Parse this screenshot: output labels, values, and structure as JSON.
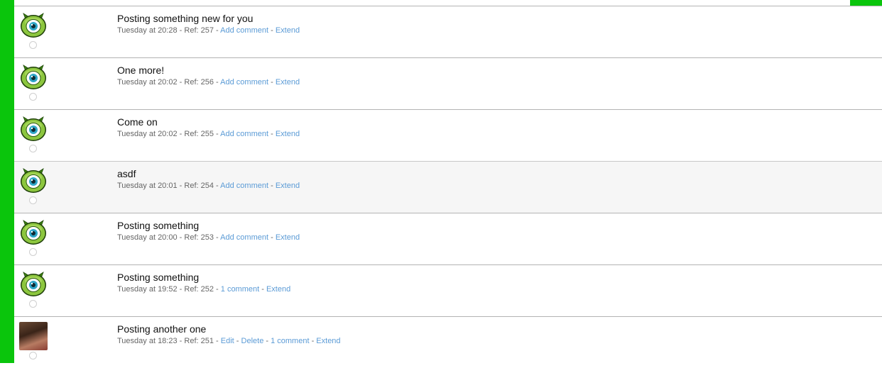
{
  "colors": {
    "accent_green": "#0ac50c",
    "link": "#5b9bd6",
    "meta_text": "#666666"
  },
  "avatar_icon": "green-one-eyed-monster-icon",
  "posts": [
    {
      "title": "Posting something new for you",
      "time": "Tuesday at 20:28",
      "ref_label": "Ref: 257",
      "links": {
        "add_comment": "Add comment",
        "extend": "Extend"
      }
    },
    {
      "title": "One more!",
      "time": "Tuesday at 20:02",
      "ref_label": "Ref: 256",
      "links": {
        "add_comment": "Add comment",
        "extend": "Extend"
      }
    },
    {
      "title": "Come on",
      "time": "Tuesday at 20:02",
      "ref_label": "Ref: 255",
      "links": {
        "add_comment": "Add comment",
        "extend": "Extend"
      }
    },
    {
      "title": "asdf",
      "time": "Tuesday at 20:01",
      "ref_label": "Ref: 254",
      "links": {
        "add_comment": "Add comment",
        "extend": "Extend"
      }
    },
    {
      "title": "Posting something",
      "time": "Tuesday at 20:00",
      "ref_label": "Ref: 253",
      "links": {
        "add_comment": "Add comment",
        "extend": "Extend"
      }
    },
    {
      "title": "Posting something",
      "time": "Tuesday at 19:52",
      "ref_label": "Ref: 252",
      "links": {
        "comments": "1 comment",
        "extend": "Extend"
      }
    },
    {
      "title": "Posting another one",
      "time": "Tuesday at 18:23",
      "ref_label": "Ref: 251",
      "links": {
        "edit": "Edit",
        "delete": "Delete",
        "comments": "1 comment",
        "extend": "Extend"
      }
    }
  ]
}
